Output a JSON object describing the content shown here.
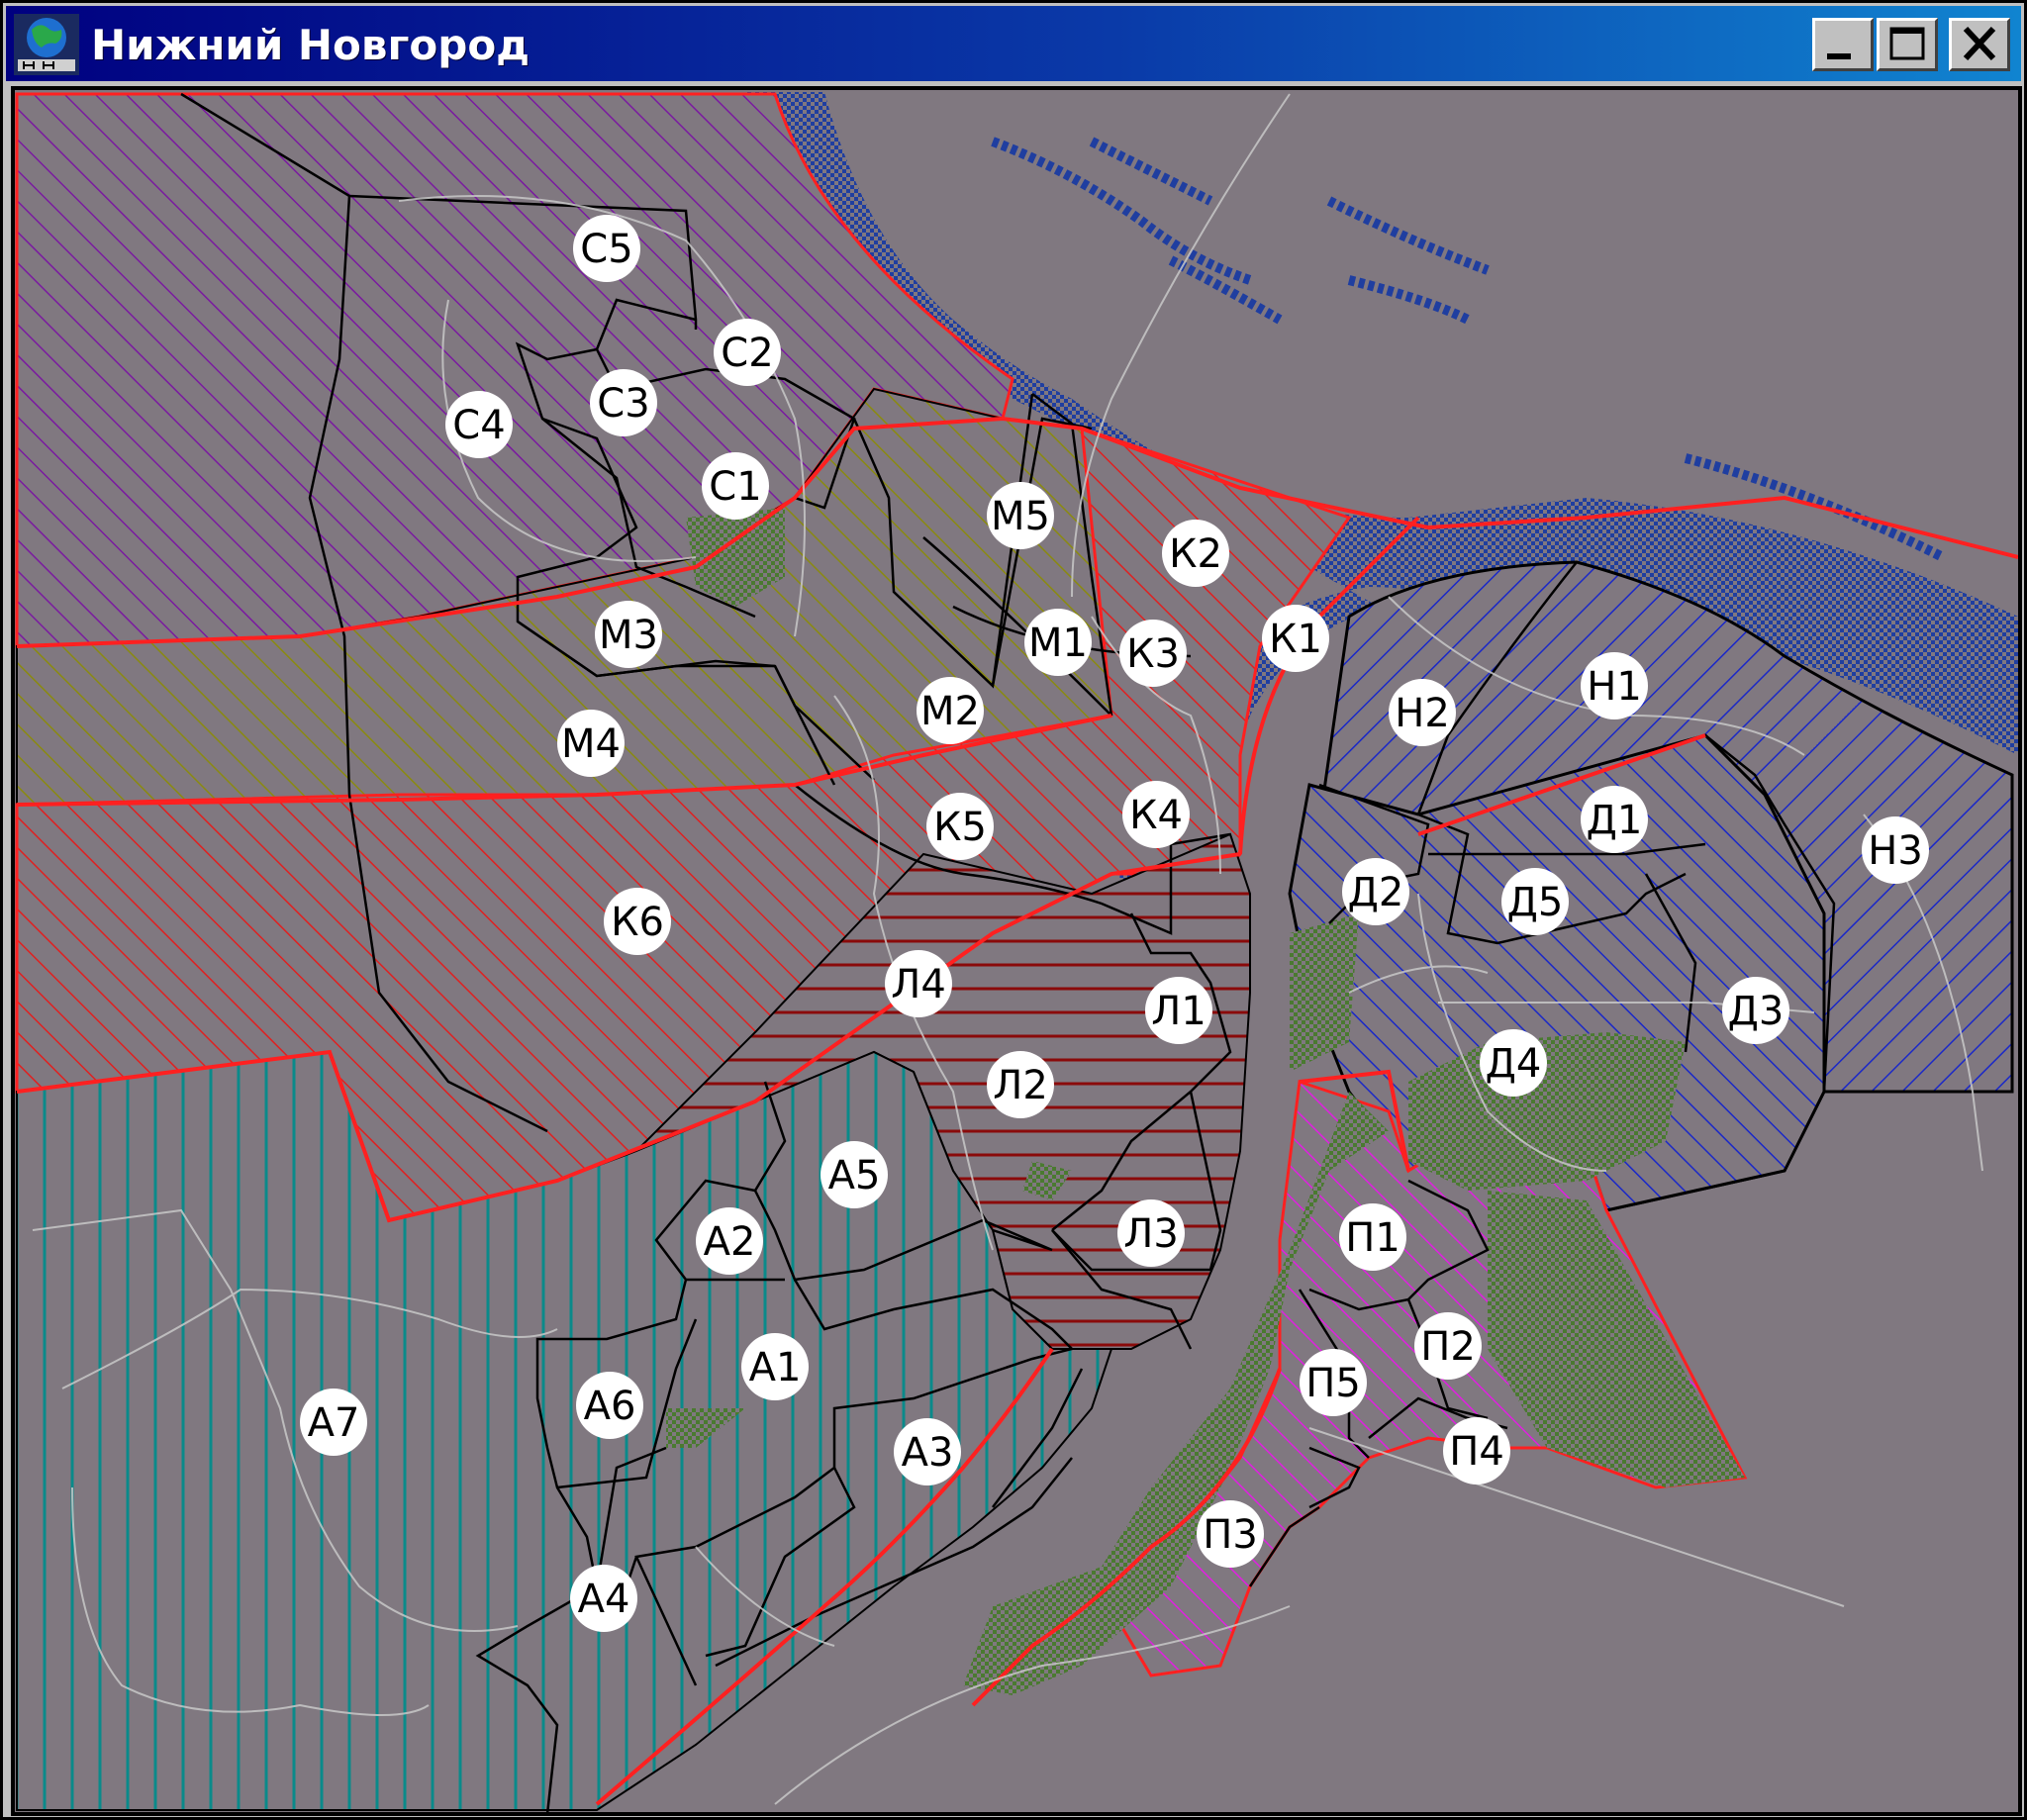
{
  "window": {
    "title": "Нижний Новгород",
    "controls": {
      "minimize": "minimize",
      "maximize": "maximize",
      "close": "close"
    }
  },
  "colors": {
    "background": "#807880",
    "window_title_bar": "#000080",
    "river": "#1f3ea0",
    "boundary_red": "#ff2020",
    "boundary_black": "#000000",
    "green_zone": "#4a7a30",
    "label_fill": "#ffffff"
  },
  "districts": [
    {
      "id": "С5",
      "group": "С"
    },
    {
      "id": "С2",
      "group": "С"
    },
    {
      "id": "С3",
      "group": "С"
    },
    {
      "id": "С4",
      "group": "С"
    },
    {
      "id": "С1",
      "group": "С"
    },
    {
      "id": "М5",
      "group": "М"
    },
    {
      "id": "М3",
      "group": "М"
    },
    {
      "id": "М1",
      "group": "М"
    },
    {
      "id": "М2",
      "group": "М"
    },
    {
      "id": "М4",
      "group": "М"
    },
    {
      "id": "К2",
      "group": "К"
    },
    {
      "id": "К1",
      "group": "К"
    },
    {
      "id": "К3",
      "group": "К"
    },
    {
      "id": "К4",
      "group": "К"
    },
    {
      "id": "К5",
      "group": "К"
    },
    {
      "id": "К6",
      "group": "К"
    },
    {
      "id": "Н1",
      "group": "Н"
    },
    {
      "id": "Н2",
      "group": "Н"
    },
    {
      "id": "Н3",
      "group": "Н"
    },
    {
      "id": "Д1",
      "group": "Д"
    },
    {
      "id": "Д2",
      "group": "Д"
    },
    {
      "id": "Д5",
      "group": "Д"
    },
    {
      "id": "Д3",
      "group": "Д"
    },
    {
      "id": "Д4",
      "group": "Д"
    },
    {
      "id": "Л4",
      "group": "Л"
    },
    {
      "id": "Л1",
      "group": "Л"
    },
    {
      "id": "Л2",
      "group": "Л"
    },
    {
      "id": "Л3",
      "group": "Л"
    },
    {
      "id": "А5",
      "group": "А"
    },
    {
      "id": "А2",
      "group": "А"
    },
    {
      "id": "А1",
      "group": "А"
    },
    {
      "id": "А6",
      "group": "А"
    },
    {
      "id": "А7",
      "group": "А"
    },
    {
      "id": "А3",
      "group": "А"
    },
    {
      "id": "А4",
      "group": "А"
    },
    {
      "id": "П1",
      "group": "П"
    },
    {
      "id": "П2",
      "group": "П"
    },
    {
      "id": "П5",
      "group": "П"
    },
    {
      "id": "П4",
      "group": "П"
    },
    {
      "id": "П3",
      "group": "П"
    }
  ]
}
